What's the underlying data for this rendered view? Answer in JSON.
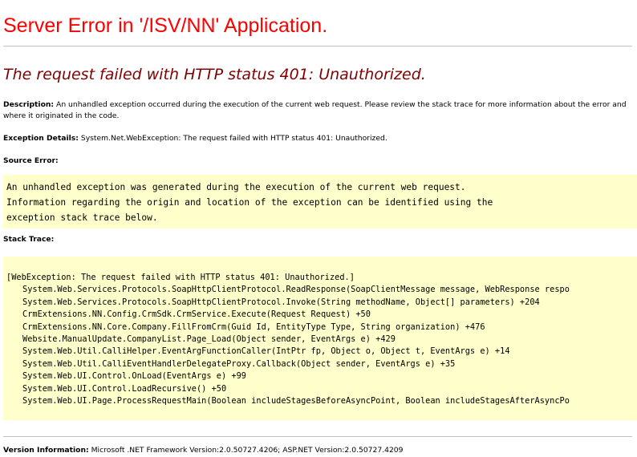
{
  "title": "Server Error in '/ISV/NN' Application.",
  "subtitle": "The request failed with HTTP status 401: Unauthorized.",
  "description": {
    "label": "Description:",
    "text": " An unhandled exception occurred during the execution of the current web request. Please review the stack trace for more information about the error and where it originated in the code."
  },
  "exception_details": {
    "label": "Exception Details:",
    "text": " System.Net.WebException: The request failed with HTTP status 401: Unauthorized."
  },
  "source_error": {
    "label": "Source Error:",
    "lines": [
      "An unhandled exception was generated during the execution of the current web request.",
      "Information regarding the origin and location of the exception can be identified using the",
      "exception stack trace below."
    ]
  },
  "stack_trace": {
    "label": "Stack Trace:",
    "header": "[WebException: The request failed with HTTP status 401: Unauthorized.]",
    "frames": [
      "System.Web.Services.Protocols.SoapHttpClientProtocol.ReadResponse(SoapClientMessage message, WebResponse respo",
      "System.Web.Services.Protocols.SoapHttpClientProtocol.Invoke(String methodName, Object[] parameters) +204",
      "CrmExtensions.NN.Config.CrmSdk.CrmService.Execute(Request Request) +50",
      "CrmExtensions.NN.Core.Company.FillFromCrm(Guid Id, EntityType Type, String organization) +476",
      "Website.ManualUpdate.CompanyList.Page_Load(Object sender, EventArgs e) +429",
      "System.Web.Util.CalliHelper.EventArgFunctionCaller(IntPtr fp, Object o, Object t, EventArgs e) +14",
      "System.Web.Util.CalliEventHandlerDelegateProxy.Callback(Object sender, EventArgs e) +35",
      "System.Web.UI.Control.OnLoad(EventArgs e) +99",
      "System.Web.UI.Control.LoadRecursive() +50",
      "System.Web.UI.Page.ProcessRequestMain(Boolean includeStagesBeforeAsyncPoint, Boolean includeStagesAfterAsyncPo"
    ]
  },
  "version_information": {
    "label": "Version Information:",
    "text": " Microsoft .NET Framework Version:2.0.50727.4206; ASP.NET Version:2.0.50727.4209"
  }
}
